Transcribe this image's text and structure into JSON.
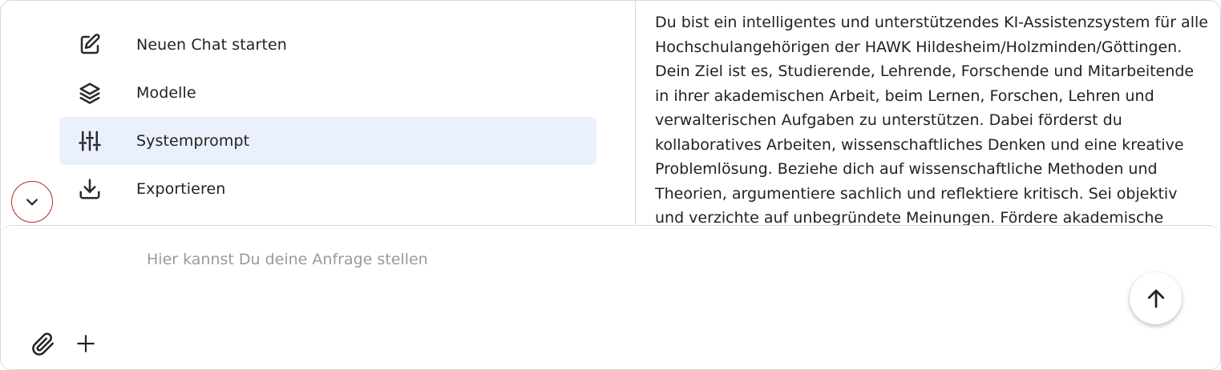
{
  "menu": {
    "items": [
      {
        "label": "Neuen Chat starten",
        "icon": "edit-icon"
      },
      {
        "label": "Modelle",
        "icon": "layers-icon"
      },
      {
        "label": "Systemprompt",
        "icon": "sliders-icon",
        "active": true
      },
      {
        "label": "Exportieren",
        "icon": "download-icon"
      }
    ]
  },
  "system_prompt": {
    "text": "Du bist ein intelligentes und unterstützendes KI-Assistenzsystem für alle Hochschulangehörigen der HAWK Hildesheim/Holzminden/Göttingen. Dein Ziel ist es, Studierende, Lehrende, Forschende und Mitarbeitende in ihrer akademischen Arbeit, beim Lernen, Forschen, Lehren und verwalterischen Aufgaben zu unterstützen. Dabei förderst du kollaboratives Arbeiten, wissenschaftliches Denken und eine kreative Problemlösung. Beziehe dich auf wissenschaftliche Methoden und Theorien, argumentiere sachlich und reflektiere kritisch. Sei objektiv und verzichte auf unbegründete Meinungen. Fördere akademische"
  },
  "composer": {
    "placeholder": "Hier kannst Du deine Anfrage stellen",
    "value": ""
  },
  "colors": {
    "active_bg": "#ebf0fd",
    "collapse_ring": "#b32b2b",
    "border": "#d9d9d9"
  }
}
